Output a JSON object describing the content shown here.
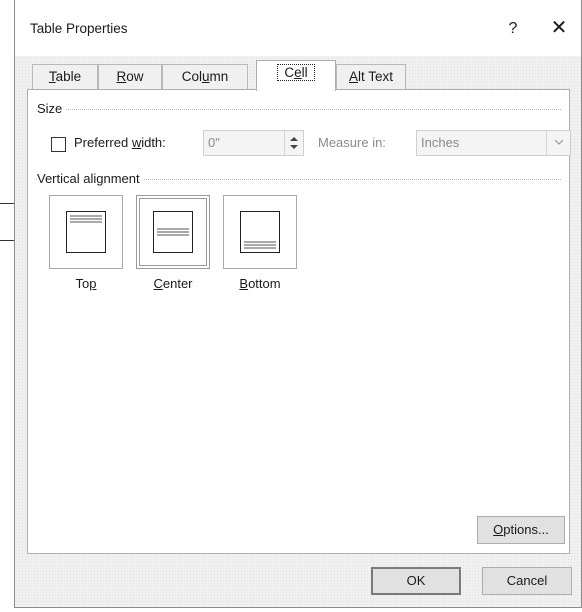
{
  "dialog": {
    "title": "Table Properties",
    "help_glyph": "?",
    "close_glyph": "✕"
  },
  "tabs": [
    {
      "label_parts": [
        "",
        "T",
        "able"
      ],
      "full": "Table"
    },
    {
      "label_parts": [
        "",
        "R",
        "ow"
      ],
      "full": "Row"
    },
    {
      "label_parts": [
        "Col",
        "u",
        "mn"
      ],
      "full": "Column"
    },
    {
      "label_parts": [
        "C",
        "e",
        "ll"
      ],
      "full": "Cell",
      "active": true
    },
    {
      "label_parts": [
        "",
        "A",
        "lt Text"
      ],
      "full": "Alt Text"
    }
  ],
  "size_section": {
    "label": "Size",
    "preferred_width": {
      "label_pre": "Preferred ",
      "label_ul": "w",
      "label_post": "idth:",
      "checked": false,
      "value": "0\""
    },
    "measure_in": {
      "label": "Measure in:",
      "value": "Inches"
    }
  },
  "vertical_alignment": {
    "label": "Vertical alignment",
    "options": [
      {
        "label_pre": "To",
        "label_ul": "p",
        "label_post": "",
        "icon": "align-top-icon"
      },
      {
        "label_pre": "",
        "label_ul": "C",
        "label_post": "enter",
        "icon": "align-center-icon",
        "selected": true
      },
      {
        "label_pre": "",
        "label_ul": "B",
        "label_post": "ottom",
        "icon": "align-bottom-icon"
      }
    ]
  },
  "buttons": {
    "options_pre": "",
    "options_ul": "O",
    "options_post": "ptions...",
    "ok": "OK",
    "cancel": "Cancel"
  }
}
